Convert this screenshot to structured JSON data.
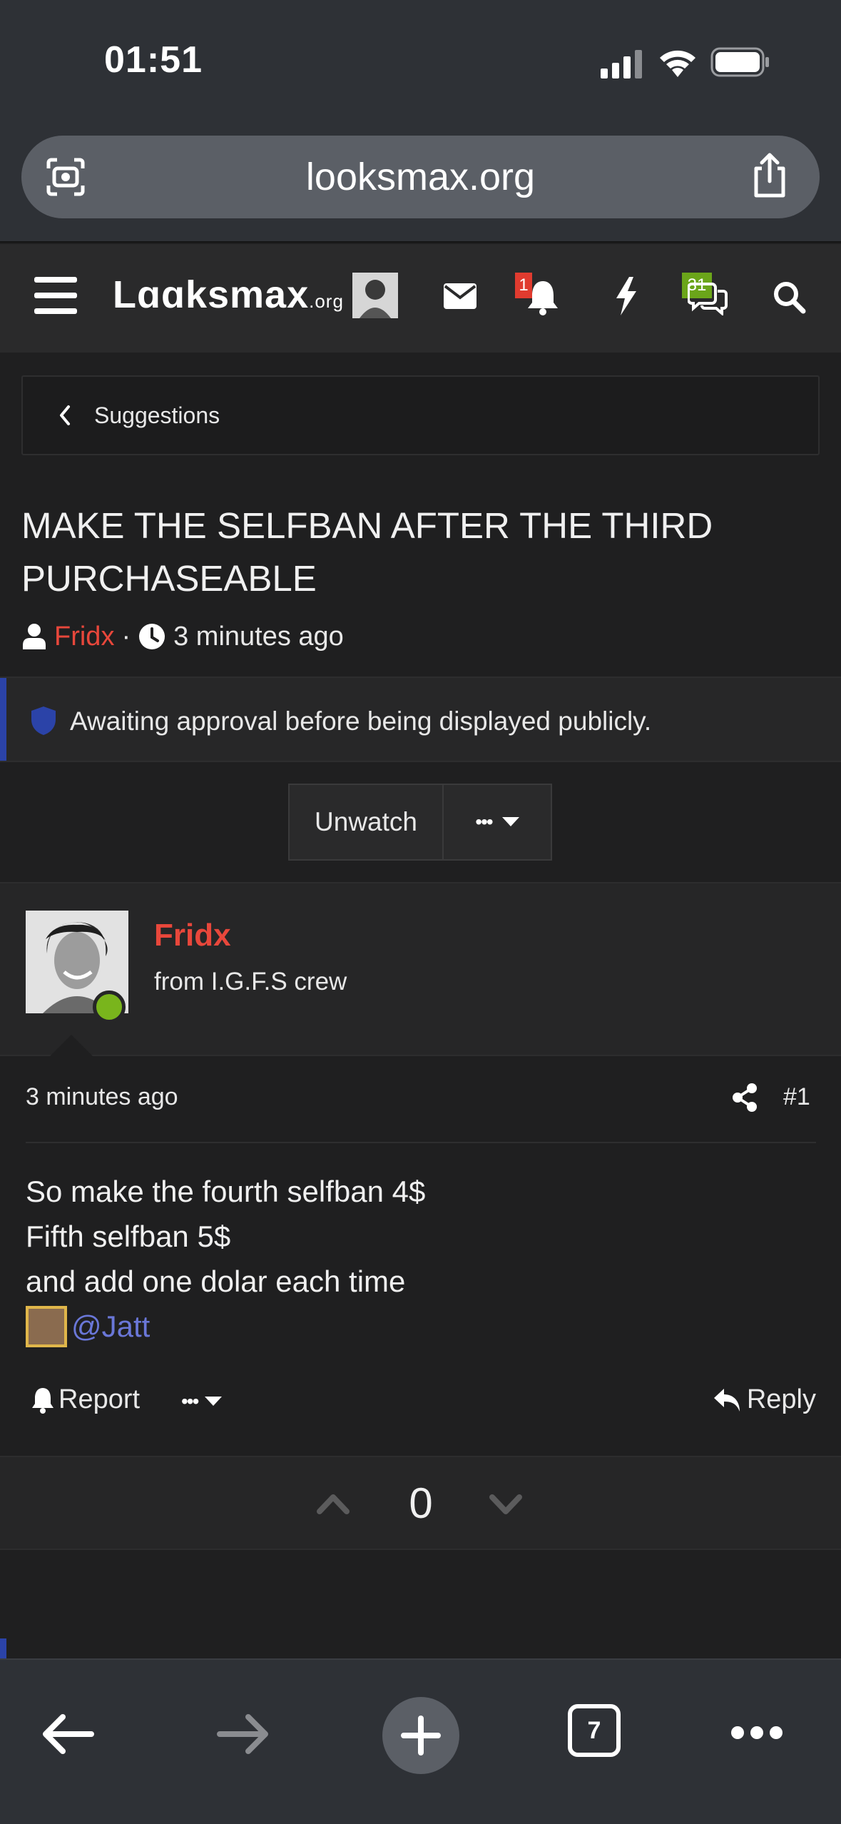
{
  "status_bar": {
    "time": "01:51"
  },
  "browser": {
    "url": "looksmax.org",
    "tabs_count": "7"
  },
  "site": {
    "logo_main": "Lɑɑksmax",
    "logo_suffix": ".org",
    "notifications_badge": "1",
    "conversations_badge": "31"
  },
  "breadcrumb": {
    "label": "Suggestions"
  },
  "thread": {
    "title": "MAKE THE SELFBAN AFTER THE THIRD PURCHASEABLE",
    "author": "Fridx",
    "separator": "·",
    "time": "3 minutes ago"
  },
  "notice": {
    "text": "Awaiting approval before being displayed publicly."
  },
  "watch": {
    "unwatch_label": "Unwatch",
    "more_label": "•••"
  },
  "post": {
    "author": "Fridx",
    "user_title": "from I.G.F.S crew",
    "time": "3 minutes ago",
    "number": "#1",
    "lines": [
      "So make the fourth selfban 4$",
      "Fifth selfban 5$",
      "and add one dolar each time"
    ],
    "mention": "@Jatt",
    "report_label": "Report",
    "more_label": "•••",
    "reply_label": "Reply"
  },
  "votes": {
    "count": "0"
  },
  "colors": {
    "brand_red": "#e8473b",
    "online": "#79b51c",
    "notice_bar": "#2b43a8",
    "mention": "#6a77d8"
  }
}
